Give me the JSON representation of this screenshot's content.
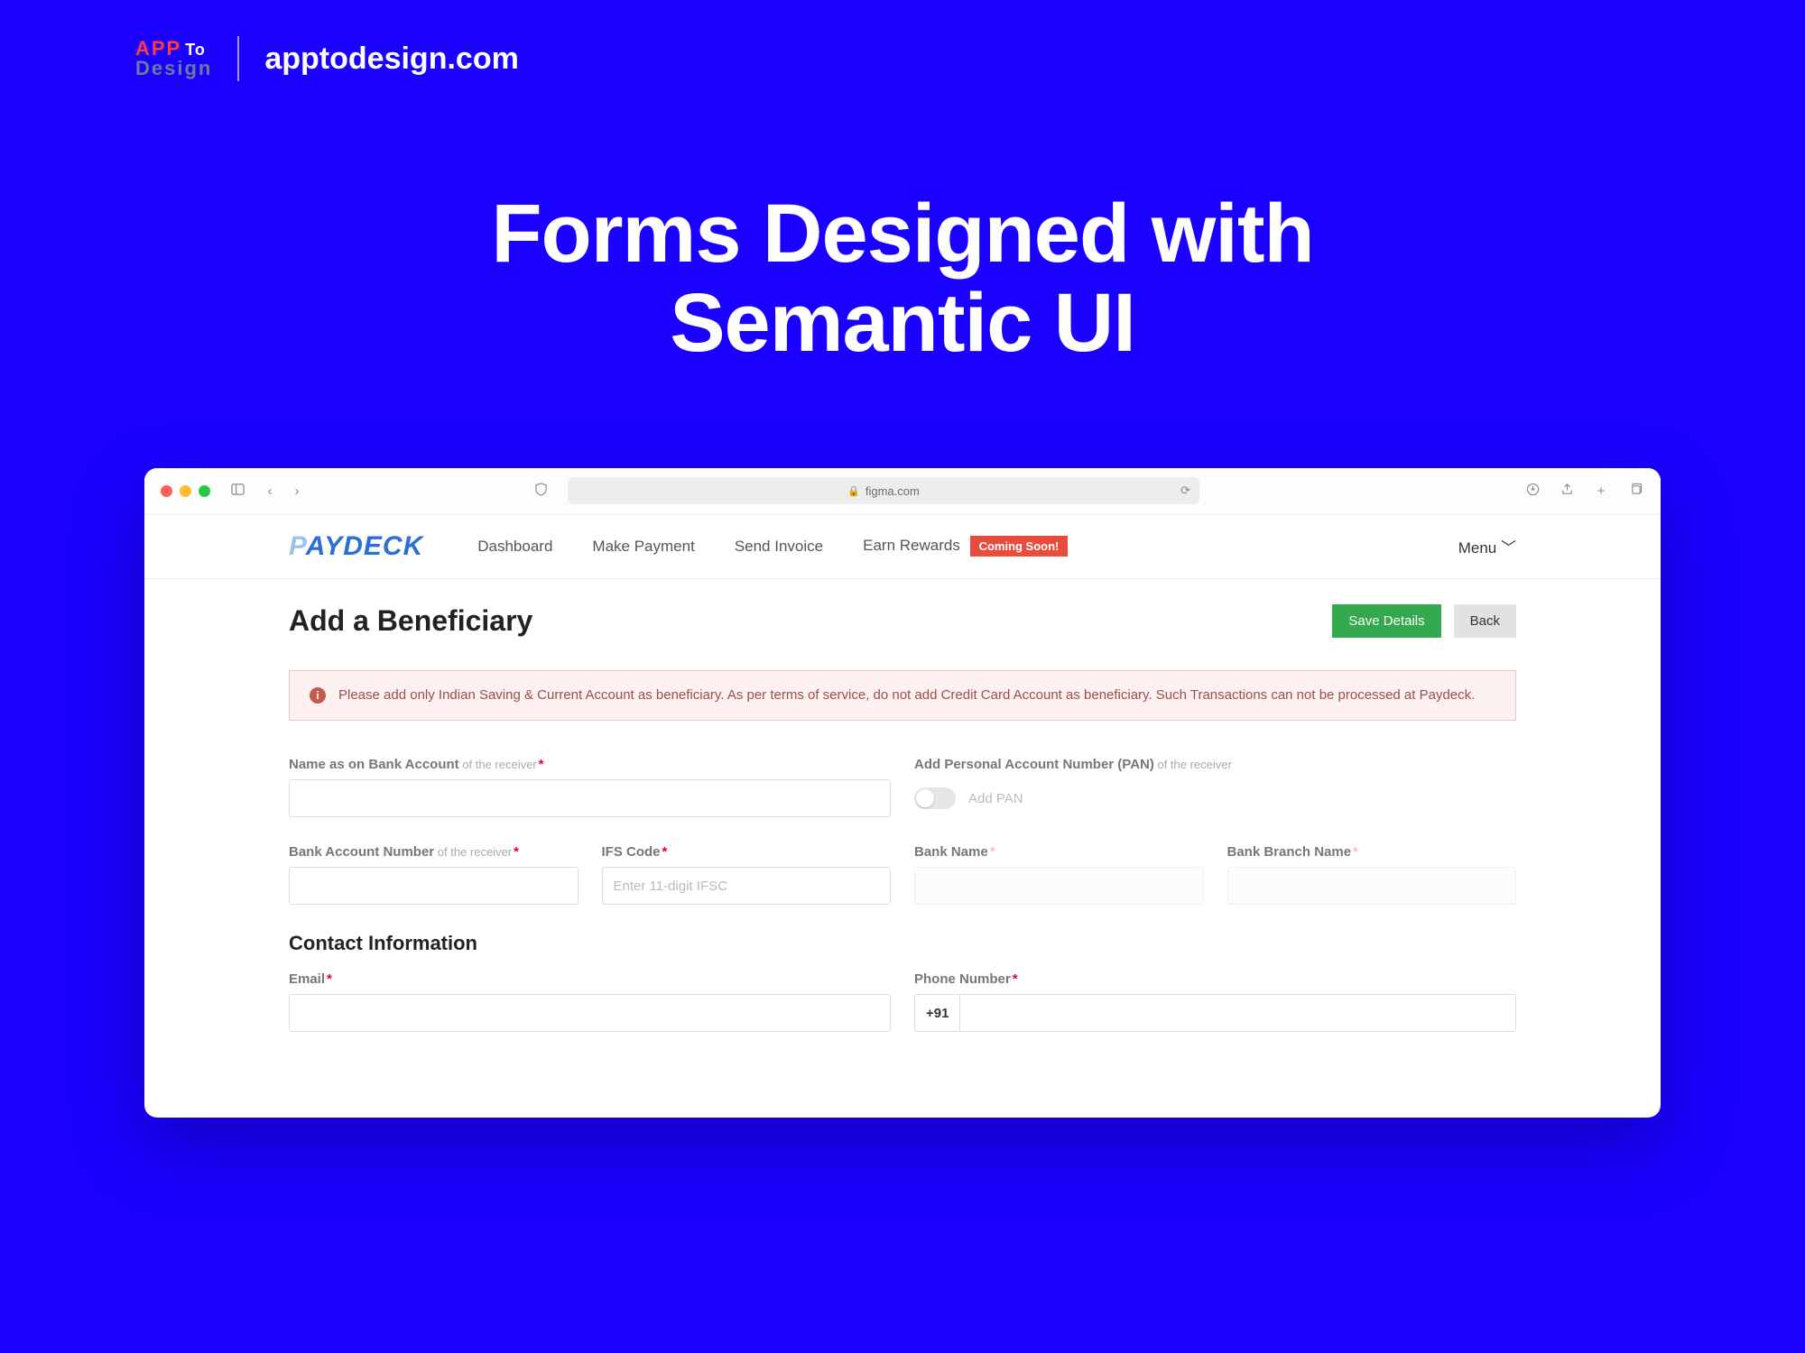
{
  "outer": {
    "logo_app": "APP",
    "logo_to": "To",
    "logo_design": "Design",
    "site_url": "apptodesign.com",
    "hero_line1": "Forms Designed with",
    "hero_line2": "Semantic UI"
  },
  "chrome": {
    "address": "figma.com"
  },
  "app": {
    "brand": "PAYDECK",
    "nav": {
      "dashboard": "Dashboard",
      "make_payment": "Make Payment",
      "send_invoice": "Send Invoice",
      "earn_rewards": "Earn Rewards",
      "coming_soon": "Coming Soon!"
    },
    "menu_label": "Menu",
    "page_title": "Add a Beneficiary",
    "actions": {
      "save": "Save Details",
      "back": "Back"
    },
    "alert_text": "Please add only Indian Saving & Current Account as beneficiary. As per terms of service, do not add Credit Card Account as beneficiary. Such Transactions can not be processed at Paydeck.",
    "fields": {
      "name_label": "Name as on Bank Account",
      "of_receiver": " of the receiver",
      "pan_label": "Add Personal Account Number (PAN)",
      "pan_toggle_label": "Add PAN",
      "account_number_label": "Bank Account Number",
      "ifs_label": "IFS Code",
      "ifs_placeholder": "Enter 11-digit IFSC",
      "bank_name_label": "Bank Name",
      "branch_label": "Bank Branch Name"
    },
    "contact": {
      "section": "Contact Information",
      "email_label": "Email",
      "phone_label": "Phone Number",
      "phone_prefix": "+91"
    }
  }
}
